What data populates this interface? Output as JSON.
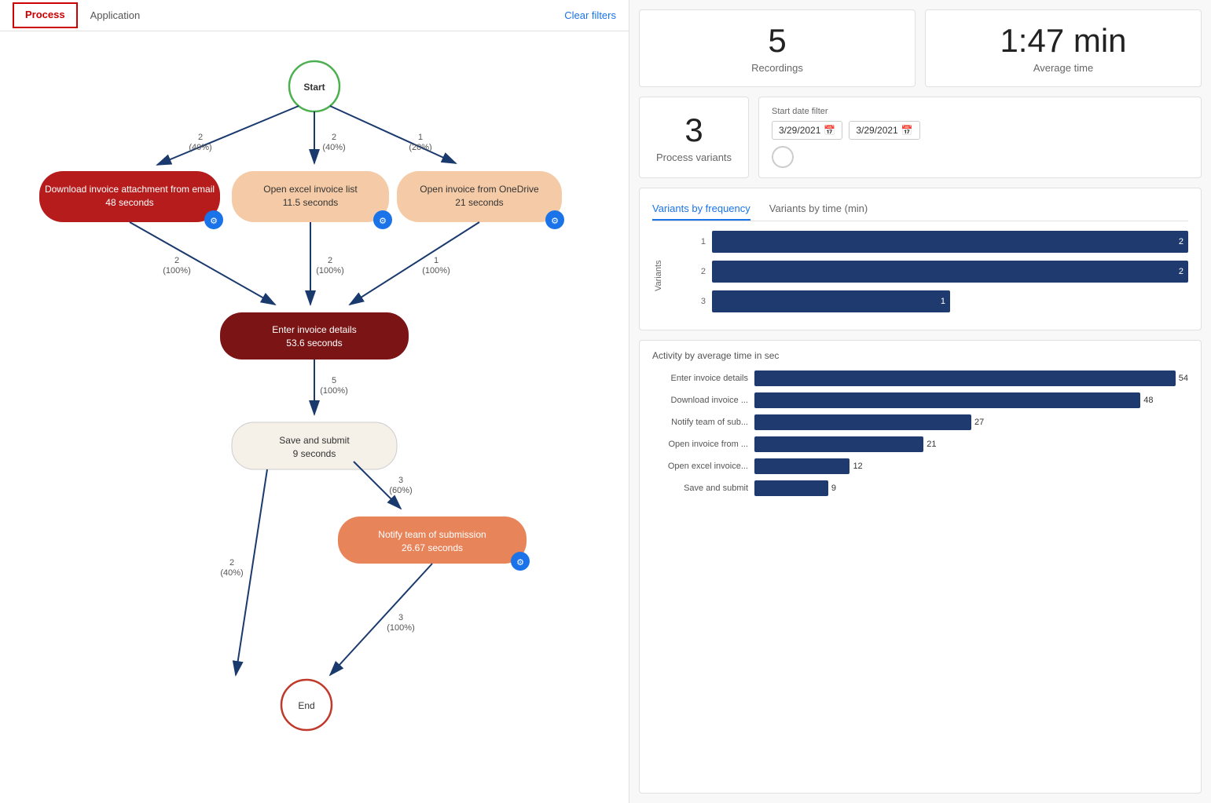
{
  "tabs": [
    {
      "id": "process",
      "label": "Process",
      "active": true
    },
    {
      "id": "application",
      "label": "Application",
      "active": false
    }
  ],
  "clear_filters": "Clear filters",
  "stats": {
    "recordings": {
      "value": "5",
      "label": "Recordings"
    },
    "average_time": {
      "value": "1:47 min",
      "label": "Average time"
    },
    "process_variants": {
      "value": "3",
      "label": "Process variants"
    }
  },
  "date_filter": {
    "label": "Start date filter",
    "start": "3/29/2021",
    "end": "3/29/2021"
  },
  "variants_chart": {
    "tab1": "Variants by frequency",
    "tab2": "Variants by time (min)",
    "y_axis_label": "Variants",
    "rows": [
      {
        "label": "1",
        "value": 2,
        "bar_pct": 100
      },
      {
        "label": "2",
        "value": 2,
        "bar_pct": 100
      },
      {
        "label": "3",
        "value": 1,
        "bar_pct": 50
      }
    ]
  },
  "activity_chart": {
    "title": "Activity by average time in sec",
    "max_value": 54,
    "rows": [
      {
        "name": "Enter invoice details",
        "value": 54,
        "pct": 100
      },
      {
        "name": "Download invoice ...",
        "value": 48,
        "pct": 89
      },
      {
        "name": "Notify team of sub...",
        "value": 27,
        "pct": 50
      },
      {
        "name": "Open invoice from ...",
        "value": 21,
        "pct": 39
      },
      {
        "name": "Open excel invoice...",
        "value": 12,
        "pct": 22
      },
      {
        "name": "Save and submit",
        "value": 9,
        "pct": 17
      }
    ]
  },
  "flow": {
    "start_label": "Start",
    "end_label": "End",
    "nodes": [
      {
        "id": "download",
        "label": "Download invoice attachment from email",
        "sublabel": "48 seconds",
        "color": "#b71c1c",
        "text_color": "#fff"
      },
      {
        "id": "open_excel",
        "label": "Open excel invoice list",
        "sublabel": "11.5 seconds",
        "color": "#f5cba7",
        "text_color": "#333"
      },
      {
        "id": "open_onedrive",
        "label": "Open invoice from OneDrive",
        "sublabel": "21 seconds",
        "color": "#f5cba7",
        "text_color": "#333"
      },
      {
        "id": "enter_invoice",
        "label": "Enter invoice details",
        "sublabel": "53.6 seconds",
        "color": "#7b1515",
        "text_color": "#fff"
      },
      {
        "id": "save_submit",
        "label": "Save and submit",
        "sublabel": "9 seconds",
        "color": "#f5f0e8",
        "text_color": "#333"
      },
      {
        "id": "notify_team",
        "label": "Notify team of submission",
        "sublabel": "26.67 seconds",
        "color": "#e8845a",
        "text_color": "#fff"
      }
    ],
    "edges": [
      {
        "from": "start",
        "to": "download",
        "count": "2",
        "pct": "40%"
      },
      {
        "from": "start",
        "to": "open_excel",
        "count": "2",
        "pct": "40%"
      },
      {
        "from": "start",
        "to": "open_onedrive",
        "count": "1",
        "pct": "20%"
      },
      {
        "from": "download",
        "to": "enter_invoice",
        "count": "2",
        "pct": "100%"
      },
      {
        "from": "open_excel",
        "to": "enter_invoice",
        "count": "2",
        "pct": "100%"
      },
      {
        "from": "open_onedrive",
        "to": "enter_invoice",
        "count": "1",
        "pct": "100%"
      },
      {
        "from": "enter_invoice",
        "to": "save_submit",
        "count": "5",
        "pct": "100%"
      },
      {
        "from": "save_submit",
        "to": "notify_team",
        "count": "3",
        "pct": "60%"
      },
      {
        "from": "save_submit",
        "to": "end",
        "count": "2",
        "pct": "40%"
      },
      {
        "from": "notify_team",
        "to": "end",
        "count": "3",
        "pct": "100%"
      }
    ]
  }
}
